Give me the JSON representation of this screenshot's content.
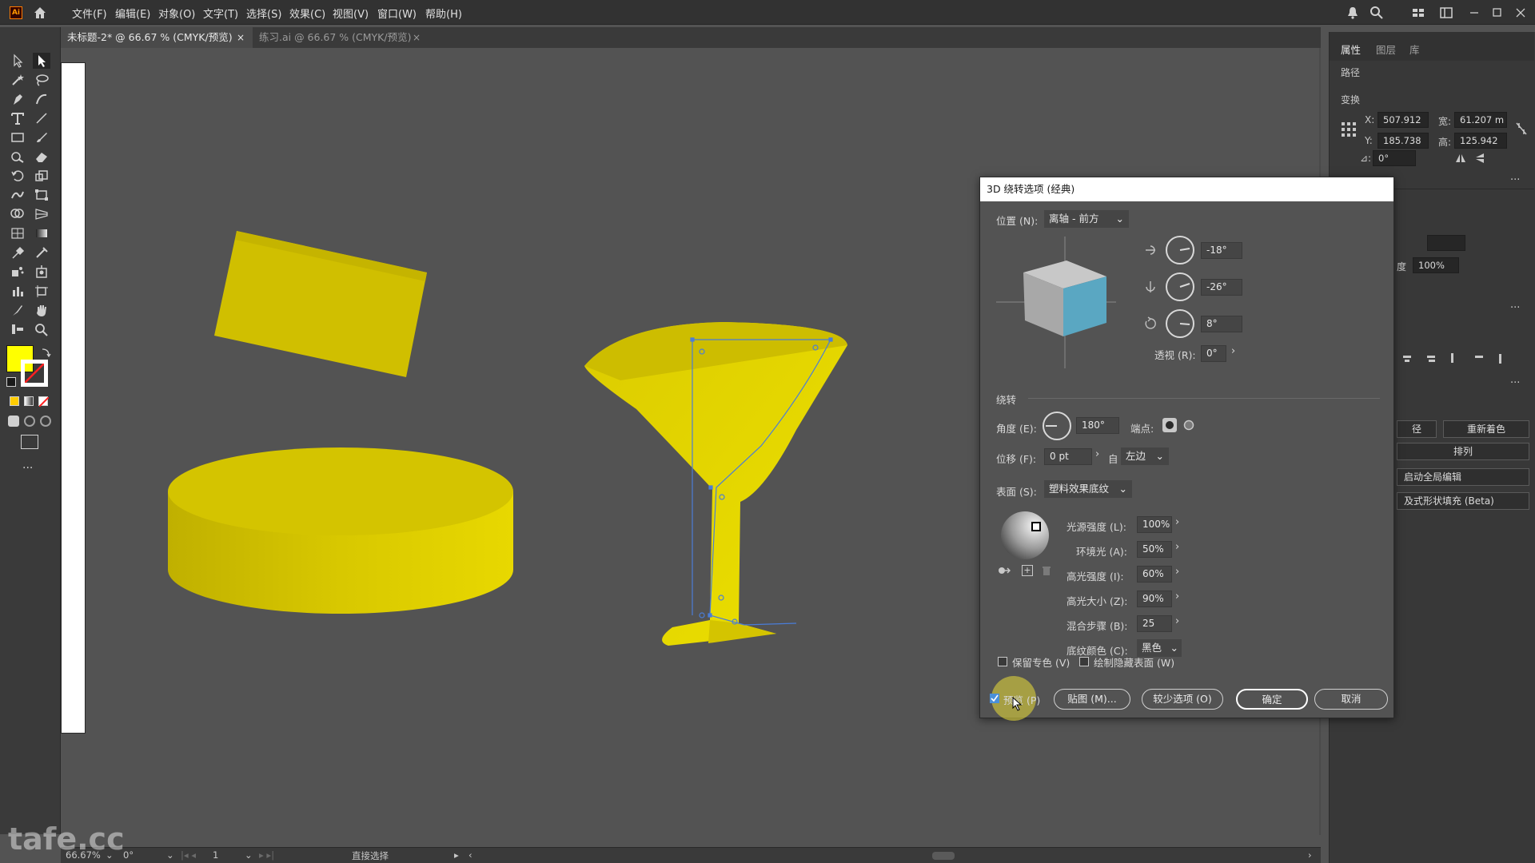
{
  "app": {
    "logo": "Ai"
  },
  "menu": [
    "文件(F)",
    "编辑(E)",
    "对象(O)",
    "文字(T)",
    "选择(S)",
    "效果(C)",
    "视图(V)",
    "窗口(W)",
    "帮助(H)"
  ],
  "tabs": [
    {
      "label": "未标题-2* @ 66.67 % (CMYK/预览)",
      "close": "×"
    },
    {
      "label": "练习.ai @ 66.67 % (CMYK/预览)",
      "close": "×"
    }
  ],
  "right_panel": {
    "tabs": [
      "属性",
      "图层",
      "库"
    ],
    "section_path": "路径",
    "section_transform": "变换",
    "x_label": "X:",
    "x_value": "507.912",
    "y_label": "Y:",
    "y_value": "185.738",
    "w_label": "宽:",
    "w_value": "61.207 m",
    "h_label": "高:",
    "h_value": "125.942",
    "angle_label": "⊿:",
    "angle_value": "0°",
    "opacity_label": "度",
    "opacity_value": "100%",
    "btn_path": "径",
    "btn_recolor": "重新着色",
    "btn_arrange": "排列",
    "btn_global_edit": "启动全局编辑",
    "btn_generative": "及式形状填充 (Beta)",
    "more": "..."
  },
  "dialog": {
    "title": "3D 绕转选项 (经典)",
    "position_label": "位置 (N):",
    "position_value": "离轴 - 前方",
    "rot_x": "-18°",
    "rot_y": "-26°",
    "rot_z": "8°",
    "perspective_label": "透视 (R):",
    "perspective_value": "0°",
    "revolve_section": "绕转",
    "angle_label": "角度 (E):",
    "angle_value": "180°",
    "cap_label": "端点:",
    "offset_label": "位移 (F):",
    "offset_value": "0 pt",
    "from_label": "自",
    "from_value": "左边",
    "surface_label": "表面 (S):",
    "surface_value": "塑料效果底纹",
    "light_intensity_label": "光源强度 (L):",
    "light_intensity_value": "100%",
    "ambient_label": "环境光 (A):",
    "ambient_value": "50%",
    "highlight_intensity_label": "高光强度 (I):",
    "highlight_intensity_value": "60%",
    "highlight_size_label": "高光大小 (Z):",
    "highlight_size_value": "90%",
    "blend_steps_label": "混合步骤 (B):",
    "blend_steps_value": "25",
    "shading_color_label": "底纹颜色 (C):",
    "shading_color_value": "黑色",
    "preserve_spot_label": "保留专色 (V)",
    "draw_hidden_label": "绘制隐藏表面 (W)",
    "preview_label": "预览 (P)",
    "map_button": "贴图 (M)...",
    "fewer_options_button": "较少选项 (O)",
    "ok_button": "确定",
    "cancel_button": "取消"
  },
  "status": {
    "zoom": "66.67%",
    "rotation": "0°",
    "artboard_num": "1",
    "tool_name": "直接选择"
  },
  "watermark": "tafe.cc",
  "colors": {
    "fill": "#ffff00",
    "object_yellow": "#d8c800",
    "cube_face": "#5aa7c2",
    "accent": "#ff9a00"
  }
}
